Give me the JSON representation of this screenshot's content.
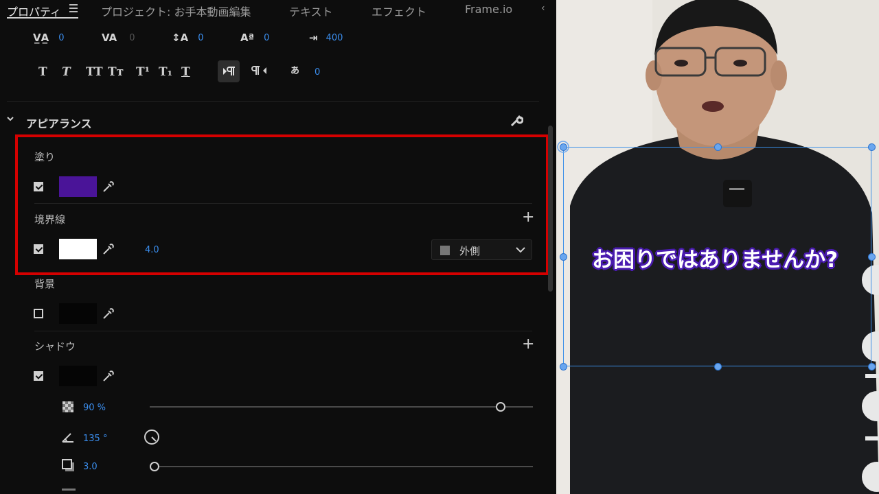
{
  "tabs": [
    {
      "label": "プロパティ",
      "active": true
    },
    {
      "label": "プロジェクト: お手本動画編集",
      "active": false
    },
    {
      "label": "テキスト",
      "active": false
    },
    {
      "label": "エフェクト",
      "active": false
    },
    {
      "label": "Frame.io",
      "active": false
    }
  ],
  "text_metrics": {
    "kerning": "0",
    "tracking": "0",
    "leading": "0",
    "baseline_shift": "0",
    "tab_width": "400",
    "tsume": "0"
  },
  "format_buttons": [
    "T",
    "T",
    "TT",
    "Tт",
    "T¹",
    "T₁",
    "T"
  ],
  "appearance": {
    "title": "アピアランス",
    "fill": {
      "label": "塗り",
      "checked": true,
      "color": "#4a1498"
    },
    "stroke": {
      "label": "境界線",
      "checked": true,
      "color": "#ffffff",
      "width": "4.0",
      "position": "外側"
    },
    "background": {
      "label": "背景",
      "checked": false,
      "color": "#050505"
    },
    "shadow": {
      "label": "シャドウ",
      "checked": true,
      "color": "#050505",
      "opacity": "90 %",
      "opacity_fraction": 0.9,
      "angle": "135 °",
      "distance": "3.0"
    }
  },
  "video": {
    "caption": "お困りではありませんか?",
    "caption_stroke_color": "#4a1bb0"
  }
}
